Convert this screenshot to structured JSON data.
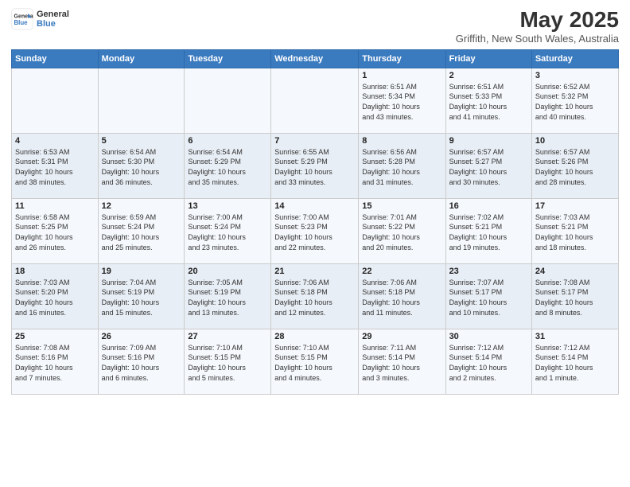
{
  "header": {
    "logo_line1": "General",
    "logo_line2": "Blue",
    "title": "May 2025",
    "subtitle": "Griffith, New South Wales, Australia"
  },
  "days_of_week": [
    "Sunday",
    "Monday",
    "Tuesday",
    "Wednesday",
    "Thursday",
    "Friday",
    "Saturday"
  ],
  "weeks": [
    [
      {
        "day": "",
        "info": ""
      },
      {
        "day": "",
        "info": ""
      },
      {
        "day": "",
        "info": ""
      },
      {
        "day": "",
        "info": ""
      },
      {
        "day": "1",
        "info": "Sunrise: 6:51 AM\nSunset: 5:34 PM\nDaylight: 10 hours\nand 43 minutes."
      },
      {
        "day": "2",
        "info": "Sunrise: 6:51 AM\nSunset: 5:33 PM\nDaylight: 10 hours\nand 41 minutes."
      },
      {
        "day": "3",
        "info": "Sunrise: 6:52 AM\nSunset: 5:32 PM\nDaylight: 10 hours\nand 40 minutes."
      }
    ],
    [
      {
        "day": "4",
        "info": "Sunrise: 6:53 AM\nSunset: 5:31 PM\nDaylight: 10 hours\nand 38 minutes."
      },
      {
        "day": "5",
        "info": "Sunrise: 6:54 AM\nSunset: 5:30 PM\nDaylight: 10 hours\nand 36 minutes."
      },
      {
        "day": "6",
        "info": "Sunrise: 6:54 AM\nSunset: 5:29 PM\nDaylight: 10 hours\nand 35 minutes."
      },
      {
        "day": "7",
        "info": "Sunrise: 6:55 AM\nSunset: 5:29 PM\nDaylight: 10 hours\nand 33 minutes."
      },
      {
        "day": "8",
        "info": "Sunrise: 6:56 AM\nSunset: 5:28 PM\nDaylight: 10 hours\nand 31 minutes."
      },
      {
        "day": "9",
        "info": "Sunrise: 6:57 AM\nSunset: 5:27 PM\nDaylight: 10 hours\nand 30 minutes."
      },
      {
        "day": "10",
        "info": "Sunrise: 6:57 AM\nSunset: 5:26 PM\nDaylight: 10 hours\nand 28 minutes."
      }
    ],
    [
      {
        "day": "11",
        "info": "Sunrise: 6:58 AM\nSunset: 5:25 PM\nDaylight: 10 hours\nand 26 minutes."
      },
      {
        "day": "12",
        "info": "Sunrise: 6:59 AM\nSunset: 5:24 PM\nDaylight: 10 hours\nand 25 minutes."
      },
      {
        "day": "13",
        "info": "Sunrise: 7:00 AM\nSunset: 5:24 PM\nDaylight: 10 hours\nand 23 minutes."
      },
      {
        "day": "14",
        "info": "Sunrise: 7:00 AM\nSunset: 5:23 PM\nDaylight: 10 hours\nand 22 minutes."
      },
      {
        "day": "15",
        "info": "Sunrise: 7:01 AM\nSunset: 5:22 PM\nDaylight: 10 hours\nand 20 minutes."
      },
      {
        "day": "16",
        "info": "Sunrise: 7:02 AM\nSunset: 5:21 PM\nDaylight: 10 hours\nand 19 minutes."
      },
      {
        "day": "17",
        "info": "Sunrise: 7:03 AM\nSunset: 5:21 PM\nDaylight: 10 hours\nand 18 minutes."
      }
    ],
    [
      {
        "day": "18",
        "info": "Sunrise: 7:03 AM\nSunset: 5:20 PM\nDaylight: 10 hours\nand 16 minutes."
      },
      {
        "day": "19",
        "info": "Sunrise: 7:04 AM\nSunset: 5:19 PM\nDaylight: 10 hours\nand 15 minutes."
      },
      {
        "day": "20",
        "info": "Sunrise: 7:05 AM\nSunset: 5:19 PM\nDaylight: 10 hours\nand 13 minutes."
      },
      {
        "day": "21",
        "info": "Sunrise: 7:06 AM\nSunset: 5:18 PM\nDaylight: 10 hours\nand 12 minutes."
      },
      {
        "day": "22",
        "info": "Sunrise: 7:06 AM\nSunset: 5:18 PM\nDaylight: 10 hours\nand 11 minutes."
      },
      {
        "day": "23",
        "info": "Sunrise: 7:07 AM\nSunset: 5:17 PM\nDaylight: 10 hours\nand 10 minutes."
      },
      {
        "day": "24",
        "info": "Sunrise: 7:08 AM\nSunset: 5:17 PM\nDaylight: 10 hours\nand 8 minutes."
      }
    ],
    [
      {
        "day": "25",
        "info": "Sunrise: 7:08 AM\nSunset: 5:16 PM\nDaylight: 10 hours\nand 7 minutes."
      },
      {
        "day": "26",
        "info": "Sunrise: 7:09 AM\nSunset: 5:16 PM\nDaylight: 10 hours\nand 6 minutes."
      },
      {
        "day": "27",
        "info": "Sunrise: 7:10 AM\nSunset: 5:15 PM\nDaylight: 10 hours\nand 5 minutes."
      },
      {
        "day": "28",
        "info": "Sunrise: 7:10 AM\nSunset: 5:15 PM\nDaylight: 10 hours\nand 4 minutes."
      },
      {
        "day": "29",
        "info": "Sunrise: 7:11 AM\nSunset: 5:14 PM\nDaylight: 10 hours\nand 3 minutes."
      },
      {
        "day": "30",
        "info": "Sunrise: 7:12 AM\nSunset: 5:14 PM\nDaylight: 10 hours\nand 2 minutes."
      },
      {
        "day": "31",
        "info": "Sunrise: 7:12 AM\nSunset: 5:14 PM\nDaylight: 10 hours\nand 1 minute."
      }
    ]
  ]
}
